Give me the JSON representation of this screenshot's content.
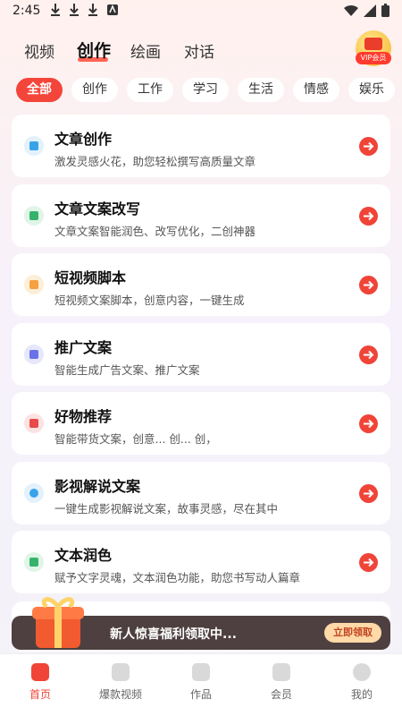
{
  "status_bar": {
    "time": "2:45"
  },
  "top_tabs": [
    {
      "label": "视频",
      "active": false
    },
    {
      "label": "创作",
      "active": true
    },
    {
      "label": "绘画",
      "active": false
    },
    {
      "label": "对话",
      "active": false
    }
  ],
  "vip": {
    "label": "VIP会员"
  },
  "filters": [
    "全部",
    "创作",
    "工作",
    "学习",
    "生活",
    "情感",
    "娱乐"
  ],
  "cards": [
    {
      "title": "文章创作",
      "desc": "激发灵感火花，助您轻松撰写高质量文章",
      "icon": "pen-icon",
      "color": "#3aa3e8"
    },
    {
      "title": "文章文案改写",
      "desc": "文章文案智能润色、改写优化，二创神器",
      "icon": "rewrite-icon",
      "color": "#36b36b"
    },
    {
      "title": "短视频脚本",
      "desc": "短视频文案脚本，创意内容，一键生成",
      "icon": "code-icon",
      "color": "#f5a142"
    },
    {
      "title": "推广文案",
      "desc": "智能生成广告文案、推广文案",
      "icon": "t-icon",
      "color": "#6b72e8"
    },
    {
      "title": "好物推荐",
      "desc": "智能带货文案，创意... 创... 创，",
      "icon": "bag-icon",
      "color": "#e84a4a"
    },
    {
      "title": "影视解说文案",
      "desc": "一键生成影视解说文案，故事灵感，尽在其中",
      "icon": "film-icon",
      "color": "#3aa3e8"
    },
    {
      "title": "文本润色",
      "desc": "赋予文字灵魂，文本润色功能，助您书写动人篇章",
      "icon": "doc-icon",
      "color": "#36b36b"
    }
  ],
  "promo": {
    "text": "新人惊喜福利领取中...",
    "button": "立即领取"
  },
  "bottom_nav": [
    {
      "label": "首页",
      "active": true
    },
    {
      "label": "爆款视频",
      "active": false
    },
    {
      "label": "作品",
      "active": false
    },
    {
      "label": "会员",
      "active": false
    },
    {
      "label": "我的",
      "active": false
    }
  ]
}
